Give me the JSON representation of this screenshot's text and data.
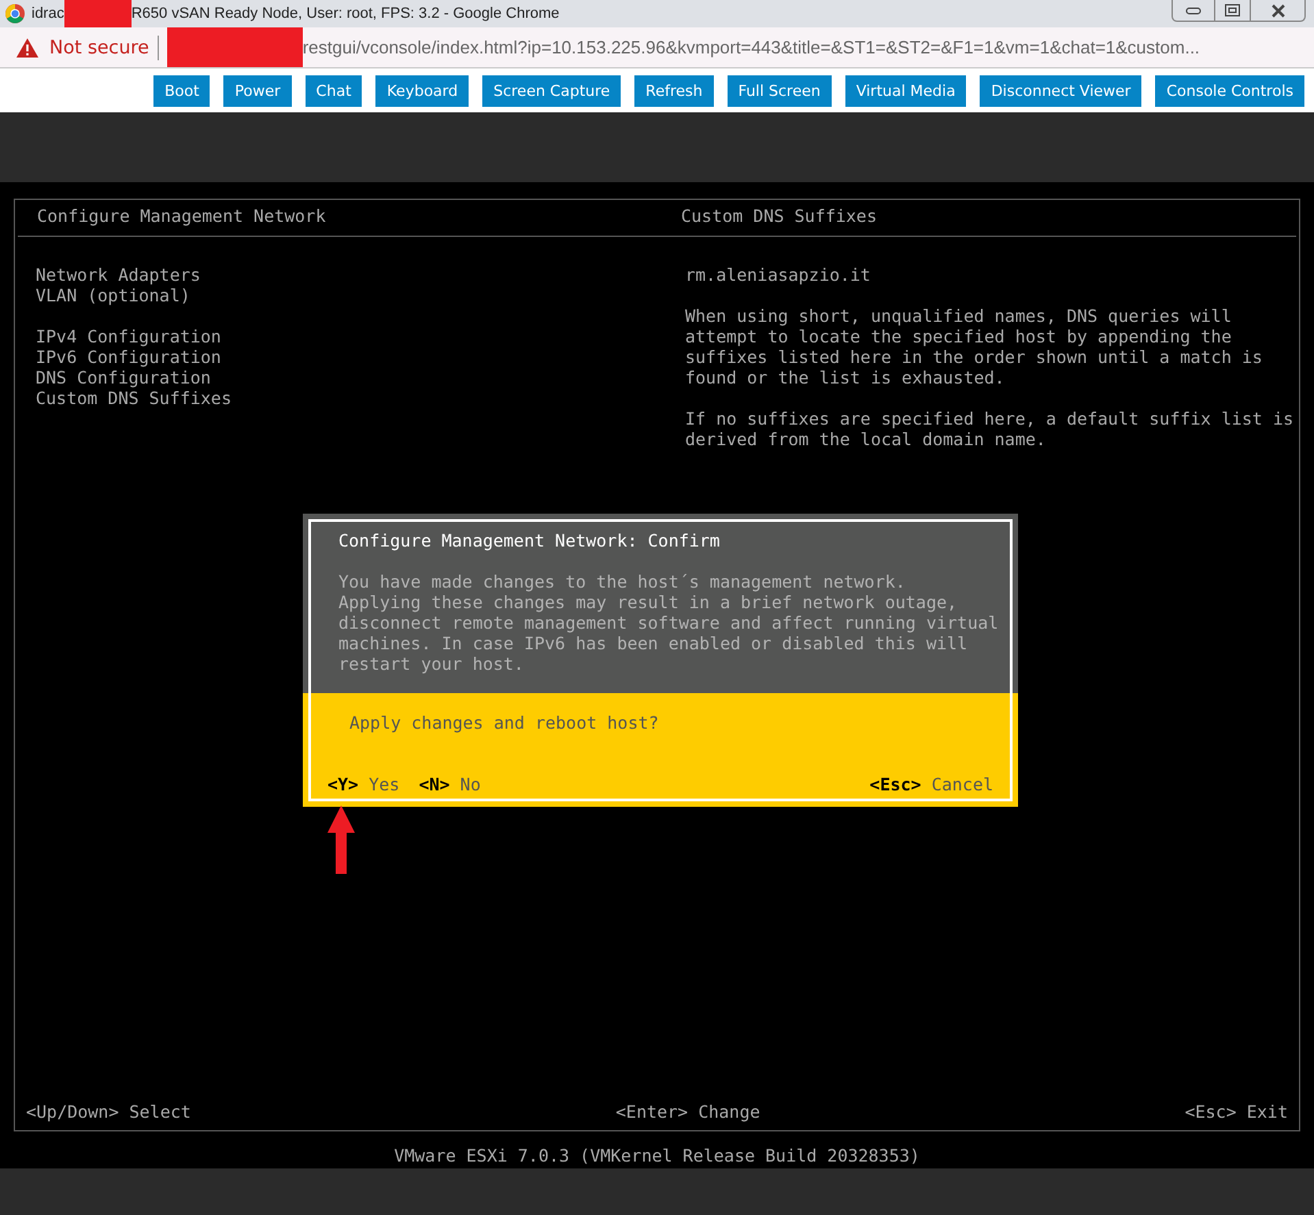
{
  "browser": {
    "title_start": "idrac",
    "title_end": "R650 vSAN Ready Node, User: root, FPS: 3.2 - Google Chrome",
    "security": "Not secure",
    "url": "restgui/vconsole/index.html?ip=10.153.225.96&kvmport=443&title=&ST1=&ST2=&F1=1&vm=1&chat=1&custom..."
  },
  "toolbar": [
    "Boot",
    "Power",
    "Chat",
    "Keyboard",
    "Screen Capture",
    "Refresh",
    "Full Screen",
    "Virtual Media",
    "Disconnect Viewer",
    "Console Controls"
  ],
  "console": {
    "left_title": "Configure Management Network",
    "menu_groups": [
      [
        "Network Adapters",
        "VLAN (optional)"
      ],
      [
        "IPv4 Configuration",
        "IPv6 Configuration",
        "DNS Configuration",
        "Custom DNS Suffixes"
      ]
    ],
    "right_title": "Custom DNS Suffixes",
    "value": "rm.aleniasapzio.it",
    "paragraphs": [
      "When using short, unqualified names, DNS queries will\nattempt to locate the specified host by appending the\nsuffixes listed here in the order shown until a match is\nfound or the list is exhausted.",
      "If no suffixes are specified here, a default suffix list is\nderived from the local domain name."
    ],
    "hints": [
      {
        "key": "<Up/Down>",
        "label": "Select"
      },
      {
        "key": "<Enter>",
        "label": "Change"
      },
      {
        "key": "<Esc>",
        "label": "Exit"
      }
    ],
    "footer": "VMware ESXi 7.0.3 (VMKernel Release Build 20328353)"
  },
  "dialog": {
    "title": "Configure Management Network: Confirm",
    "message": "You have made changes to the host´s management network.\nApplying these changes may result in a brief network outage,\ndisconnect remote management software and affect running virtual\nmachines. In case IPv6 has been enabled or disabled this will\nrestart your host.",
    "question": "Apply changes and reboot host?",
    "actions": [
      {
        "key": "<Y>",
        "label": "Yes"
      },
      {
        "key": "<N>",
        "label": "No"
      },
      {
        "key": "<Esc>",
        "label": "Cancel"
      }
    ]
  }
}
